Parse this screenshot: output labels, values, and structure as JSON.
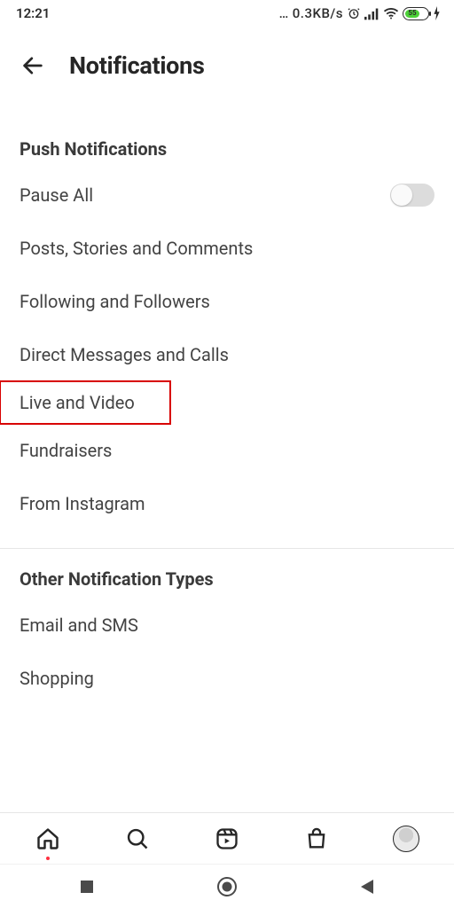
{
  "statusbar": {
    "time": "12:21",
    "net_speed": "0.3KB/s",
    "battery_percent": 55
  },
  "header": {
    "title": "Notifications"
  },
  "sections": [
    {
      "title": "Push Notifications",
      "items": [
        {
          "key": "pause_all",
          "label": "Pause All",
          "toggle": true,
          "on": false,
          "highlight": false
        },
        {
          "key": "posts",
          "label": "Posts, Stories and Comments",
          "toggle": false,
          "highlight": false
        },
        {
          "key": "following",
          "label": "Following and Followers",
          "toggle": false,
          "highlight": false
        },
        {
          "key": "dms",
          "label": "Direct Messages and Calls",
          "toggle": false,
          "highlight": false
        },
        {
          "key": "live",
          "label": "Live and Video",
          "toggle": false,
          "highlight": true
        },
        {
          "key": "fundraisers",
          "label": "Fundraisers",
          "toggle": false,
          "highlight": false
        },
        {
          "key": "from_ig",
          "label": "From Instagram",
          "toggle": false,
          "highlight": false
        }
      ]
    },
    {
      "title": "Other Notification Types",
      "items": [
        {
          "key": "email_sms",
          "label": "Email and SMS",
          "toggle": false,
          "highlight": false
        },
        {
          "key": "shopping",
          "label": "Shopping",
          "toggle": false,
          "highlight": false
        }
      ]
    }
  ],
  "app_nav": {
    "home": "home-icon",
    "search": "search-icon",
    "reels": "reels-icon",
    "shop": "shop-icon",
    "profile": "avatar"
  },
  "sys_nav": {
    "recents": "recents-icon",
    "home": "sys-home-icon",
    "back": "sys-back-icon"
  },
  "colors": {
    "highlight_border": "#d80000",
    "battery_fill": "#4cd137"
  }
}
